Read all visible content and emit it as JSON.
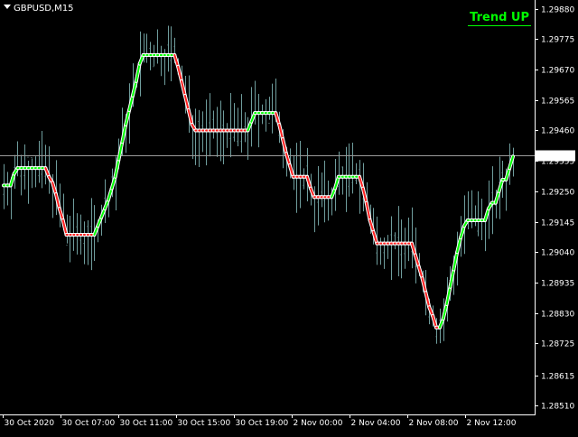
{
  "symbol_label": "GBPUSD,M15",
  "trend_label": "Trend UP",
  "colors": {
    "background": "#000000",
    "foreground": "#ffffff",
    "bar": "#6f9d9d",
    "line_up": "#00ff00",
    "line_down": "#ff2020",
    "line_glow": "#ffffff",
    "price_line": "#9a9a9a"
  },
  "chart_data": {
    "type": "line",
    "symbol": "GBPUSD",
    "timeframe": "M15",
    "ylim": [
      1.2848,
      1.2991
    ],
    "y_ticks": [
      "1.29880",
      "1.29775",
      "1.29670",
      "1.29565",
      "1.29460",
      "1.29355",
      "1.29250",
      "1.29145",
      "1.29040",
      "1.28935",
      "1.28830",
      "1.28725",
      "1.28615",
      "1.28510"
    ],
    "x_ticks": [
      "30 Oct 2020",
      "30 Oct 07:00",
      "30 Oct 11:00",
      "30 Oct 15:00",
      "30 Oct 19:00",
      "2 Nov 00:00",
      "2 Nov 04:00",
      "2 Nov 08:00",
      "2 Nov 12:00"
    ],
    "current_price": "1.29373",
    "current_price_value": 1.29373,
    "legend": "top-right",
    "grid": false,
    "series": [
      {
        "name": "Trend UP",
        "points": [
          [
            1.2927,
            "up"
          ],
          [
            1.2927,
            "up"
          ],
          [
            1.2927,
            "up"
          ],
          [
            1.2931,
            "up"
          ],
          [
            1.2933,
            "up"
          ],
          [
            1.2933,
            "up"
          ],
          [
            1.2933,
            "up"
          ],
          [
            1.2933,
            "up"
          ],
          [
            1.2933,
            "up"
          ],
          [
            1.2933,
            "up"
          ],
          [
            1.2933,
            "up"
          ],
          [
            1.2933,
            "up"
          ],
          [
            1.2933,
            "up"
          ],
          [
            1.293,
            "down"
          ],
          [
            1.2928,
            "down"
          ],
          [
            1.2924,
            "down"
          ],
          [
            1.2919,
            "down"
          ],
          [
            1.2915,
            "down"
          ],
          [
            1.291,
            "down"
          ],
          [
            1.291,
            "down"
          ],
          [
            1.291,
            "down"
          ],
          [
            1.291,
            "down"
          ],
          [
            1.291,
            "down"
          ],
          [
            1.291,
            "down"
          ],
          [
            1.291,
            "down"
          ],
          [
            1.291,
            "down"
          ],
          [
            1.291,
            "down"
          ],
          [
            1.2913,
            "up"
          ],
          [
            1.2916,
            "up"
          ],
          [
            1.2919,
            "up"
          ],
          [
            1.2922,
            "up"
          ],
          [
            1.2926,
            "up"
          ],
          [
            1.293,
            "up"
          ],
          [
            1.2936,
            "up"
          ],
          [
            1.2942,
            "up"
          ],
          [
            1.2948,
            "up"
          ],
          [
            1.2953,
            "up"
          ],
          [
            1.2958,
            "up"
          ],
          [
            1.2963,
            "up"
          ],
          [
            1.2969,
            "up"
          ],
          [
            1.2972,
            "up"
          ],
          [
            1.2972,
            "up"
          ],
          [
            1.2972,
            "up"
          ],
          [
            1.2972,
            "up"
          ],
          [
            1.2972,
            "up"
          ],
          [
            1.2972,
            "up"
          ],
          [
            1.2972,
            "up"
          ],
          [
            1.2972,
            "up"
          ],
          [
            1.2972,
            "up"
          ],
          [
            1.2972,
            "up"
          ],
          [
            1.2968,
            "down"
          ],
          [
            1.2963,
            "down"
          ],
          [
            1.2958,
            "down"
          ],
          [
            1.2953,
            "down"
          ],
          [
            1.2948,
            "down"
          ],
          [
            1.2946,
            "down"
          ],
          [
            1.2946,
            "down"
          ],
          [
            1.2946,
            "down"
          ],
          [
            1.2946,
            "down"
          ],
          [
            1.2946,
            "down"
          ],
          [
            1.2946,
            "down"
          ],
          [
            1.2946,
            "down"
          ],
          [
            1.2946,
            "down"
          ],
          [
            1.2946,
            "down"
          ],
          [
            1.2946,
            "down"
          ],
          [
            1.2946,
            "down"
          ],
          [
            1.2946,
            "down"
          ],
          [
            1.2946,
            "down"
          ],
          [
            1.2946,
            "down"
          ],
          [
            1.2946,
            "down"
          ],
          [
            1.2946,
            "down"
          ],
          [
            1.2949,
            "up"
          ],
          [
            1.2952,
            "up"
          ],
          [
            1.2952,
            "up"
          ],
          [
            1.2952,
            "up"
          ],
          [
            1.2952,
            "up"
          ],
          [
            1.2952,
            "up"
          ],
          [
            1.2952,
            "up"
          ],
          [
            1.2952,
            "up"
          ],
          [
            1.2948,
            "down"
          ],
          [
            1.2943,
            "down"
          ],
          [
            1.2938,
            "down"
          ],
          [
            1.2934,
            "down"
          ],
          [
            1.293,
            "down"
          ],
          [
            1.293,
            "down"
          ],
          [
            1.293,
            "down"
          ],
          [
            1.293,
            "down"
          ],
          [
            1.293,
            "down"
          ],
          [
            1.2926,
            "down"
          ],
          [
            1.2923,
            "down"
          ],
          [
            1.2923,
            "down"
          ],
          [
            1.2923,
            "down"
          ],
          [
            1.2923,
            "down"
          ],
          [
            1.2923,
            "down"
          ],
          [
            1.2923,
            "down"
          ],
          [
            1.2926,
            "up"
          ],
          [
            1.293,
            "up"
          ],
          [
            1.293,
            "up"
          ],
          [
            1.293,
            "up"
          ],
          [
            1.293,
            "up"
          ],
          [
            1.293,
            "up"
          ],
          [
            1.293,
            "up"
          ],
          [
            1.293,
            "up"
          ],
          [
            1.2926,
            "down"
          ],
          [
            1.2921,
            "down"
          ],
          [
            1.2915,
            "down"
          ],
          [
            1.2911,
            "down"
          ],
          [
            1.2907,
            "down"
          ],
          [
            1.2907,
            "down"
          ],
          [
            1.2907,
            "down"
          ],
          [
            1.2907,
            "down"
          ],
          [
            1.2907,
            "down"
          ],
          [
            1.2907,
            "down"
          ],
          [
            1.2907,
            "down"
          ],
          [
            1.2907,
            "down"
          ],
          [
            1.2907,
            "down"
          ],
          [
            1.2907,
            "down"
          ],
          [
            1.2907,
            "down"
          ],
          [
            1.2903,
            "down"
          ],
          [
            1.2899,
            "down"
          ],
          [
            1.2895,
            "down"
          ],
          [
            1.289,
            "down"
          ],
          [
            1.2885,
            "down"
          ],
          [
            1.2882,
            "down"
          ],
          [
            1.2878,
            "down"
          ],
          [
            1.2878,
            "down"
          ],
          [
            1.2881,
            "up"
          ],
          [
            1.2886,
            "up"
          ],
          [
            1.2892,
            "up"
          ],
          [
            1.2898,
            "up"
          ],
          [
            1.2904,
            "up"
          ],
          [
            1.2909,
            "up"
          ],
          [
            1.2913,
            "up"
          ],
          [
            1.2915,
            "up"
          ],
          [
            1.2915,
            "up"
          ],
          [
            1.2915,
            "up"
          ],
          [
            1.2915,
            "up"
          ],
          [
            1.2915,
            "up"
          ],
          [
            1.2915,
            "up"
          ],
          [
            1.2919,
            "up"
          ],
          [
            1.2921,
            "up"
          ],
          [
            1.2921,
            "up"
          ],
          [
            1.2925,
            "up"
          ],
          [
            1.2929,
            "up"
          ],
          [
            1.2929,
            "up"
          ],
          [
            1.2933,
            "up"
          ],
          [
            1.2937,
            "up"
          ]
        ]
      }
    ]
  }
}
